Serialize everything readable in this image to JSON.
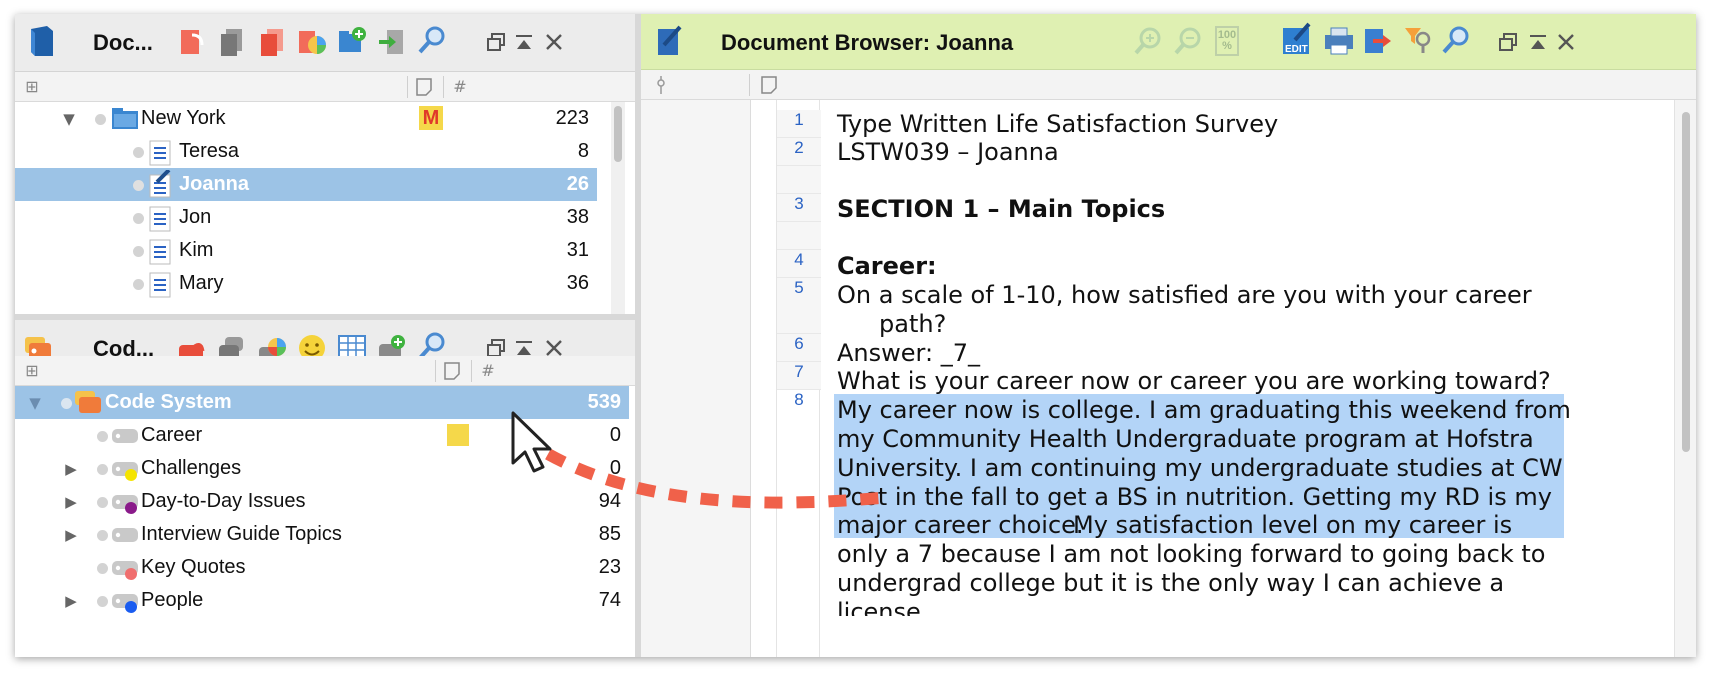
{
  "document_pane": {
    "title": "Doc...",
    "tree": [
      {
        "label": "New York",
        "count": "223",
        "memo_badge": "M",
        "type": "group",
        "expanded": true
      },
      {
        "label": "Teresa",
        "count": "8",
        "type": "document"
      },
      {
        "label": "Joanna",
        "count": "26",
        "type": "document",
        "selected": true
      },
      {
        "label": "Jon",
        "count": "38",
        "type": "document"
      },
      {
        "label": "Kim",
        "count": "31",
        "type": "document"
      },
      {
        "label": "Mary",
        "count": "36",
        "type": "document"
      }
    ],
    "column_icons": [
      "tree-icon",
      "memo-icon",
      "#"
    ]
  },
  "code_pane": {
    "title": "Cod...",
    "tree": [
      {
        "label": "Code System",
        "count": "539",
        "selected": true,
        "expanded": true
      },
      {
        "label": "Career",
        "count": "0",
        "color": "#f5d84a"
      },
      {
        "label": "Challenges",
        "count": "0",
        "color": "#f5e400",
        "has_children": true
      },
      {
        "label": "Day-to-Day Issues",
        "count": "94",
        "color": "#8a1a8a",
        "has_children": true
      },
      {
        "label": "Interview Guide Topics",
        "count": "85",
        "has_children": true
      },
      {
        "label": "Key Quotes",
        "count": "23",
        "color": "#f06e6e"
      },
      {
        "label": "People",
        "count": "74",
        "color": "#1a5cf0",
        "has_children": true
      }
    ],
    "hash_header": "#"
  },
  "browser": {
    "title": "Document Browser: Joanna",
    "lines": [
      {
        "num": "1",
        "text": "Type Written Life Satisfaction Survey"
      },
      {
        "num": "2",
        "text": "LSTW039 – Joanna"
      },
      {
        "num": "3",
        "text": "SECTION 1 – Main Topics",
        "bold": true
      },
      {
        "num": "4",
        "text": "Career:",
        "bold": true
      },
      {
        "num": "5",
        "text": "On a scale of 1-10, how satisfied are you with your career",
        "cont": "path?"
      },
      {
        "num": "6",
        "text": "Answer: _7_"
      },
      {
        "num": "7",
        "text": "What is your career now or career you are working toward?"
      },
      {
        "num": "8",
        "hl1": "My career now is college. I am graduating this weekend from",
        "hl2": "my Community Health Undergraduate program at Hofstra",
        "hl3": "University.  I am continuing my undergraduate studies at CW",
        "hl4": "Post in the fall to get a BS in nutrition.  Getting my RD is my",
        "hl5": "major career choice.",
        "rest5": "  My satisfaction level on my career is",
        "rest6": "only a 7 because I am not looking forward to going back to",
        "rest7": "undergrad college but it is the only way I can achieve a",
        "rest8": "license."
      }
    ],
    "toolbar": {
      "edit_label": "EDIT",
      "zoom_label": "100 %"
    }
  },
  "colors": {
    "selection": "#9cc3e6",
    "highlight": "#b3d4f7",
    "browser_toolbar": "#dff0b2",
    "drag_arrow": "#f0614a",
    "line_numbers": "#2b63c4"
  }
}
